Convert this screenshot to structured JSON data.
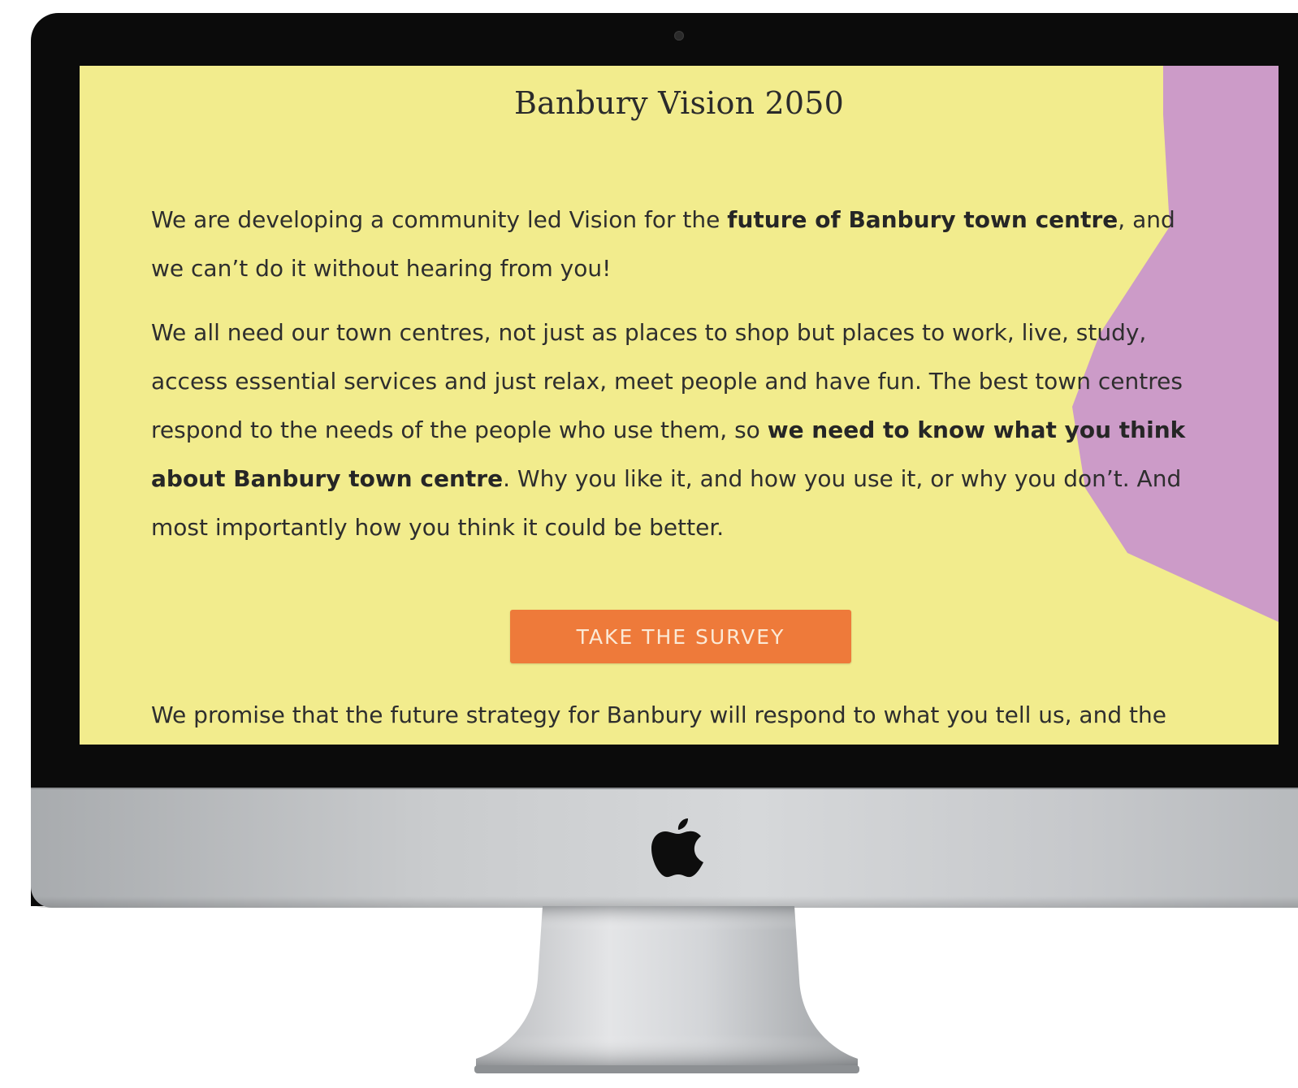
{
  "page": {
    "title": "Banbury Vision 2050",
    "paragraph1": {
      "part1": "We are developing a community led Vision for the ",
      "bold1": "future of Banbury town centre",
      "part2": ", and we can’t do it without hearing from you!"
    },
    "paragraph2": {
      "part1": "We all need our town centres, not just as places to shop but places to work, live, study, access essential services and just relax, meet people and have fun. The best town centres respond to the needs of the people who use them, so ",
      "bold1": "we need to know what you think about Banbury town centre",
      "part2": ". Why you like it, and how you use it, or why you don’t. And most importantly how you think it could be better."
    },
    "cta_label": "TAKE THE SURVEY",
    "footer_text": "We promise that the future strategy for Banbury will respond to what you tell us, and the"
  },
  "colors": {
    "background": "#f2ec8d",
    "accent_shape": "#cc9bc8",
    "button": "#ee7a3a",
    "button_text": "#fbe9d6",
    "text": "#2e2e2e"
  },
  "icons": {
    "brand": "apple-logo-icon",
    "camera": "camera-icon"
  }
}
